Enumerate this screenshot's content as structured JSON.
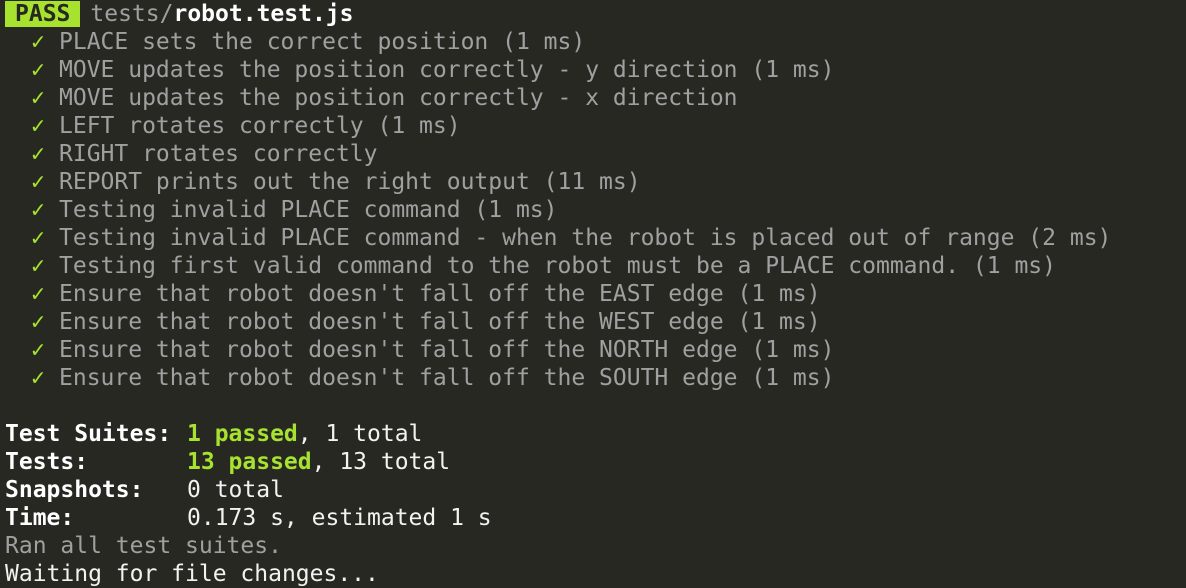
{
  "header": {
    "badge": "PASS",
    "path_dir": "tests/",
    "path_file": "robot.test.js"
  },
  "check_glyph": "✓",
  "tests": [
    "PLACE sets the correct position (1 ms)",
    "MOVE updates the position correctly - y direction (1 ms)",
    "MOVE updates the position correctly - x direction",
    "LEFT rotates correctly (1 ms)",
    "RIGHT rotates correctly",
    "REPORT prints out the right output (11 ms)",
    "Testing invalid PLACE command (1 ms)",
    "Testing invalid PLACE command - when the robot is placed out of range (2 ms)",
    "Testing first valid command to the robot must be a PLACE command. (1 ms)",
    "Ensure that robot doesn't fall off the EAST edge (1 ms)",
    "Ensure that robot doesn't fall off the WEST edge (1 ms)",
    "Ensure that robot doesn't fall off the NORTH edge (1 ms)",
    "Ensure that robot doesn't fall off the SOUTH edge (1 ms)"
  ],
  "summary": {
    "suites_label": "Test Suites:",
    "suites_passed": "1 passed",
    "suites_rest": ", 1 total",
    "tests_label": "Tests:",
    "tests_passed": "13 passed",
    "tests_rest": ", 13 total",
    "snapshots_label": "Snapshots:",
    "snapshots_value": "0 total",
    "time_label": "Time:",
    "time_value": "0.173 s, estimated 1 s"
  },
  "footer": {
    "ran_all": "Ran all test suites.",
    "watching": "Waiting for file changes..."
  },
  "colors": {
    "background": "#272822",
    "pass_green": "#a6e22e",
    "dim_text": "#a0a0a0",
    "text": "#f2f2f0"
  }
}
